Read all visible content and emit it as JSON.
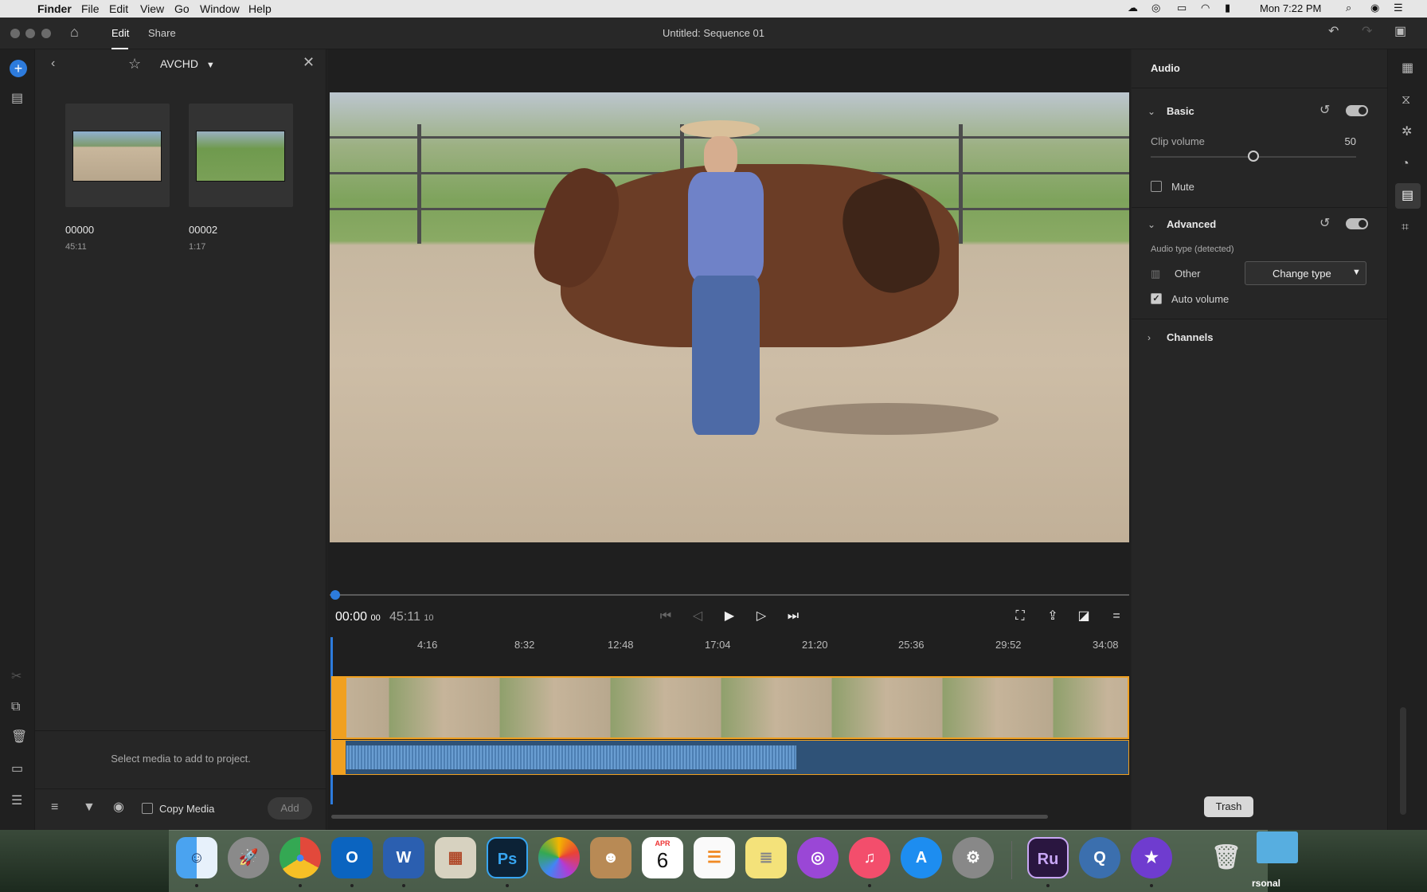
{
  "menubar": {
    "app_name": "Finder",
    "items": [
      "File",
      "Edit",
      "View",
      "Go",
      "Window",
      "Help"
    ],
    "clock": "Mon 7:22 PM"
  },
  "window": {
    "title": "Untitled: Sequence 01",
    "tabs": [
      "Edit",
      "Share"
    ],
    "active_tab": "Edit"
  },
  "media_panel": {
    "folder": "AVCHD",
    "clips": [
      {
        "name": "00000",
        "duration": "45:11"
      },
      {
        "name": "00002",
        "duration": "1:17"
      }
    ],
    "hint": "Select media to add to project.",
    "copy_media_label": "Copy Media",
    "copy_media_checked": false,
    "add_label": "Add"
  },
  "timecode": {
    "current_main": "00:00",
    "current_frames": "00",
    "total_main": "45:11",
    "total_frames": "10"
  },
  "timeline": {
    "marks": [
      "4:16",
      "8:32",
      "12:48",
      "17:04",
      "21:20",
      "25:36",
      "29:52",
      "34:08"
    ]
  },
  "audio_panel": {
    "title": "Audio",
    "basic": {
      "label": "Basic",
      "enabled": true,
      "clip_volume_label": "Clip volume",
      "clip_volume_value": "50",
      "clip_volume_level": 0.5,
      "mute_label": "Mute",
      "mute_checked": false
    },
    "advanced": {
      "label": "Advanced",
      "enabled": true,
      "audio_type_label": "Audio type (detected)",
      "audio_type_value": "Other",
      "change_type_label": "Change type",
      "auto_volume_label": "Auto volume",
      "auto_volume_checked": true
    },
    "channels_label": "Channels"
  },
  "dock": {
    "tooltip": "Trash",
    "calendar_month": "APR",
    "calendar_day": "6",
    "personal_label": "rsonal",
    "apps": [
      "finder-icon",
      "launchpad-icon",
      "chrome-icon",
      "outlook-icon",
      "word-icon",
      "calculator-icon",
      "photoshop-icon",
      "photos-icon",
      "contacts-icon",
      "calendar-icon",
      "reminders-icon",
      "notes-icon",
      "podcasts-icon",
      "music-icon",
      "app-store-icon",
      "system-preferences-icon",
      "premiere-rush-icon",
      "quicktime-icon",
      "imovie-icon",
      "trash-icon"
    ]
  },
  "colors": {
    "accent": "#2d7bdc",
    "timeline_orange": "#f0a020",
    "audio_wave": "#5b8fc4"
  }
}
